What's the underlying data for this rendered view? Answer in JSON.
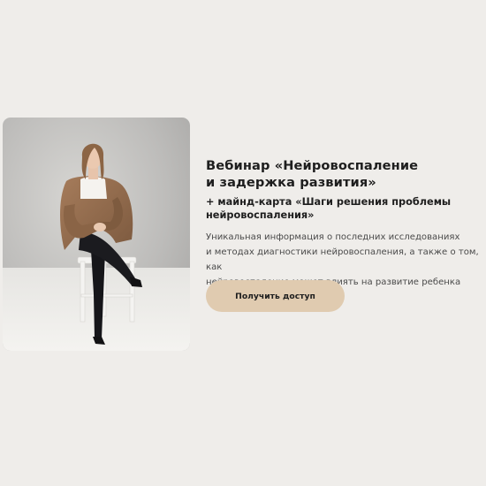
{
  "webinar": {
    "title_line1": "Вебинар «Нейровоспаление",
    "title_line2": "и задержка развития»",
    "subtitle_line1": "+ майнд-карта «Шаги решения проблемы",
    "subtitle_line2": "нейровоспаления»",
    "description_line1": "Уникальная информация о последних исследованиях",
    "description_line2": "и методах диагностики нейровоспаления, а также о том, как",
    "description_line3": "нейровоспаление может влиять на развитие ребенка",
    "button_label": "Получить доступ"
  },
  "colors": {
    "background": "#efedea",
    "button": "#e0cbb0",
    "text": "#1e1e1e"
  }
}
